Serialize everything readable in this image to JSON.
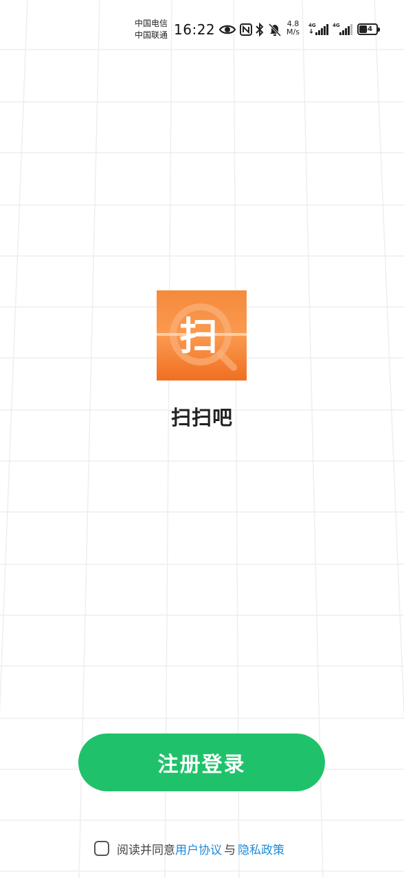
{
  "status_bar": {
    "carrier_1": "中国电信",
    "carrier_2": "中国联通",
    "time": "16:22",
    "net_speed_value": "4.8",
    "net_speed_unit": "M/s",
    "sim1_network": "4G",
    "sim2_network": "4G",
    "battery": "44"
  },
  "app": {
    "logo_glyph": "扫",
    "name": "扫扫吧"
  },
  "register_button": {
    "label": "注册登录"
  },
  "agreement": {
    "prefix": "阅读并同意",
    "user_agreement": "用户协议",
    "separator": "与",
    "privacy_policy": "隐私政策",
    "checked": false
  },
  "colors": {
    "button_green": "#1fc26a",
    "logo_orange": "#f47a2d",
    "link_blue": "#1e8ad8"
  }
}
